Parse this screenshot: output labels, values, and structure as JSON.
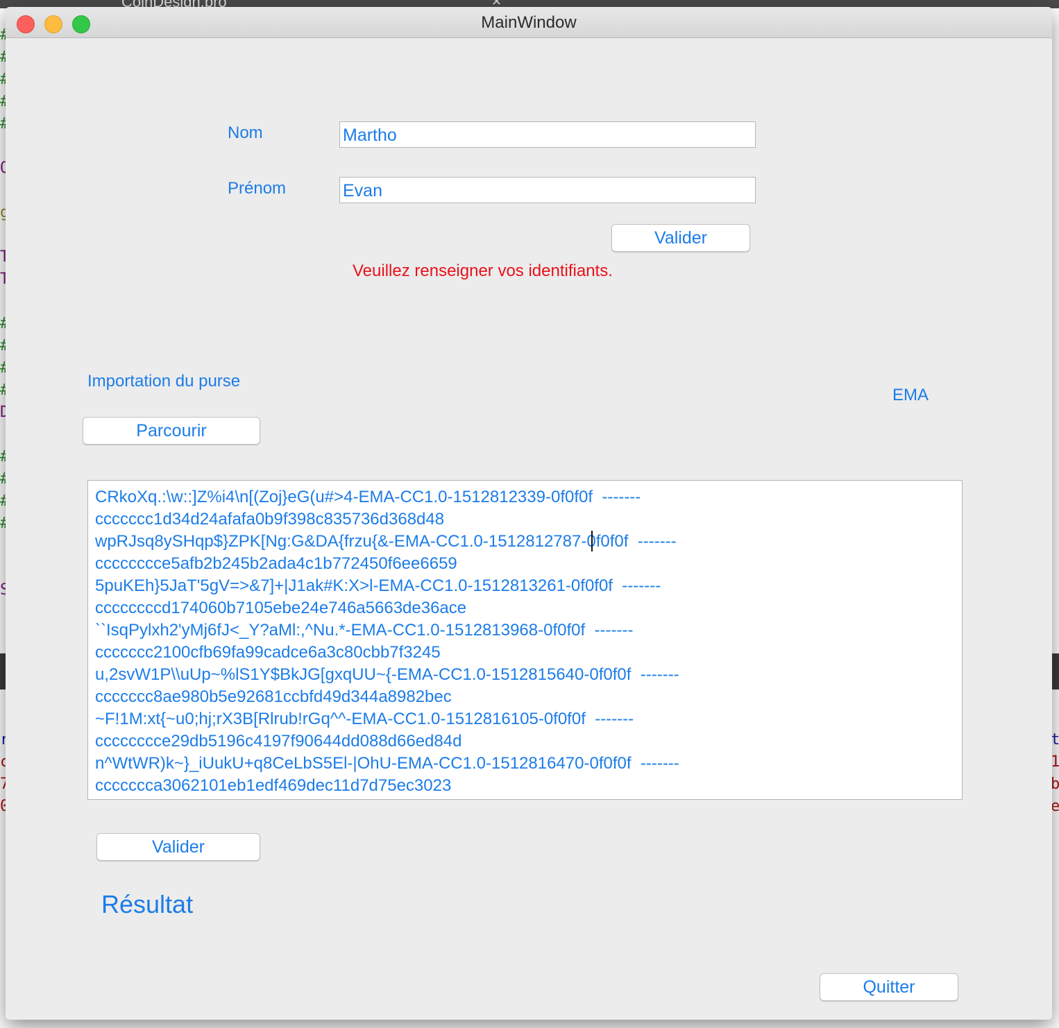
{
  "window": {
    "title": "MainWindow"
  },
  "background": {
    "tab_name": "CoinDesign.pro",
    "tab_close": "✕"
  },
  "login": {
    "nom_label": "Nom",
    "nom_value": "Martho",
    "prenom_label": "Prénom",
    "prenom_value": "Evan",
    "validate_label": "Valider",
    "error_message": "Veuillez renseigner vos identifiants."
  },
  "purse": {
    "import_label": "Importation du purse",
    "ema_label": "EMA",
    "browse_label": "Parcourir",
    "lines": [
      "CRkoXq.:\\w::]Z%i4\\n[(Zoj}eG(u#>4-EMA-CC1.0-1512812339-0f0f0f  -------",
      "ccccccc1d34d24afafa0b9f398c835736d368d48",
      "wpRJsq8ySHqp$}ZPK[Ng:G&DA{frzu{&-EMA-CC1.0-1512812787-0f0f0f  -------",
      "cccccccce5afb2b245b2ada4c1b772450f6ee6659",
      "5puKEh}5JaT'5gV=>&7]+|J1ak#K:X>l-EMA-CC1.0-1512813261-0f0f0f  -------",
      "ccccccccd174060b7105ebe24e746a5663de36ace",
      "``IsqPylxh2'yMj6fJ<_Y?aMl:,^Nu.*-EMA-CC1.0-1512813968-0f0f0f  -------",
      "ccccccc2100cfb69fa99cadce6a3c80cbb7f3245",
      "u,2svW1P\\\\uUp~%lS1Y$BkJG[gxqUU~{-EMA-CC1.0-1512815640-0f0f0f  -------",
      "ccccccc8ae980b5e92681ccbfd49d344a8982bec",
      "~F!1M:xt{~u0;hj;rX3B[Rlrub!rGq^^-EMA-CC1.0-1512816105-0f0f0f  -------",
      "cccccccce29db5196c4197f90644dd088d66ed84d",
      "n^WtWR)k~}_iUukU+q8CeLbS5El-|OhU-EMA-CC1.0-1512816470-0f0f0f  -------",
      "ccccccca3062101eb1edf469dec11d7d75ec3023"
    ],
    "validate_label": "Valider"
  },
  "result": {
    "label": "Résultat"
  },
  "footer": {
    "quit_label": "Quitter"
  },
  "colors": {
    "accent": "#1c7ce8",
    "error": "#e8111a",
    "window_bg": "#ececec"
  }
}
